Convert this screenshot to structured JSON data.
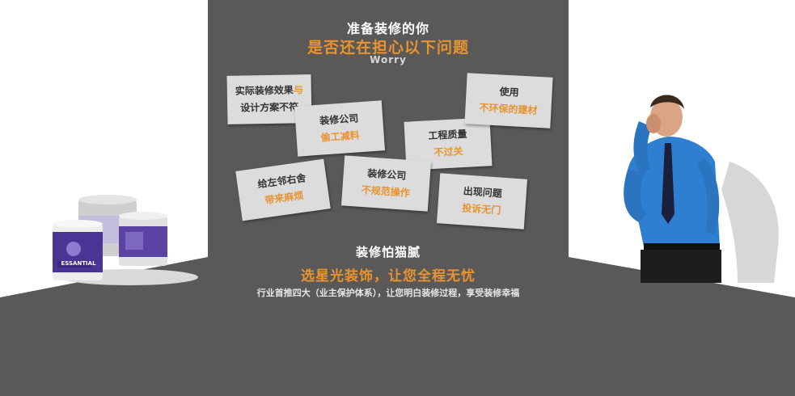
{
  "header": {
    "line1": "准备装修的你",
    "line2": "是否还在担心以下问题",
    "line3": "Worry"
  },
  "cards": [
    {
      "dark": "实际装修效果",
      "orange": "与",
      "line2": "设计方案不符"
    },
    {
      "line1": "装修公司",
      "line2": "偷工减料"
    },
    {
      "line1": "工程质量",
      "line2": "不过关"
    },
    {
      "line1": "使用",
      "line2": "不环保的建材"
    },
    {
      "line1": "给左邻右舍",
      "line2": "带来麻烦"
    },
    {
      "line1": "装修公司",
      "line2": "不规范操作"
    },
    {
      "line1": "出现问题",
      "line2": "投诉无门"
    }
  ],
  "footer": {
    "line1": "装修怕猫腻",
    "line2": "选星光装饰，让您全程无忧",
    "line3": "行业首推四大（业主保护体系），让您明白装修过程，享受装修幸福"
  },
  "product": {
    "brand": "ESSANTIAL"
  },
  "colors": {
    "panel": "#5a5958",
    "accent": "#e8932f",
    "card": "#dcdcdc"
  }
}
